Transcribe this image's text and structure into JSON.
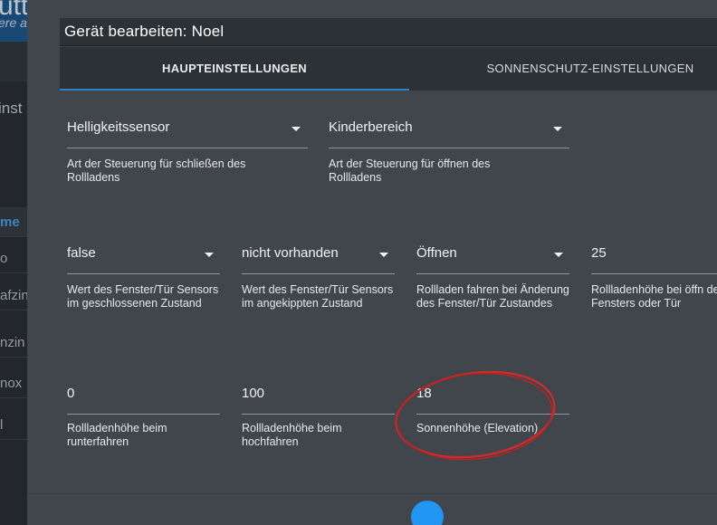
{
  "background": {
    "title_fragment": "utt",
    "subtitle_fragment": "ere a",
    "section_fragment": "inst",
    "list_items": [
      {
        "label": "me",
        "active": true
      },
      {
        "label": "o",
        "active": false
      },
      {
        "label": "afzin",
        "active": false
      },
      {
        "label": "nzin",
        "active": false
      },
      {
        "label": "nox",
        "active": false
      },
      {
        "label": "l",
        "active": false
      }
    ]
  },
  "dialog": {
    "title": "Gerät bearbeiten: Noel",
    "tabs": [
      {
        "label": "HAUPTEINSTELLUNGEN",
        "active": true
      },
      {
        "label": "SONNENSCHUTZ-EINSTELLUNGEN",
        "active": false
      }
    ],
    "fields": {
      "close_control": {
        "value": "Helligkeitssensor",
        "helper": "Art der Steuerung für schließen des Rollladens",
        "type": "select"
      },
      "open_control": {
        "value": "Kinderbereich",
        "helper": "Art der Steuerung für öffnen des Rollladens",
        "type": "select"
      },
      "window_closed": {
        "value": "false",
        "helper": "Wert des Fenster/Tür Sensors im geschlossenen Zustand",
        "type": "select"
      },
      "window_tilted": {
        "value": "nicht vorhanden",
        "helper": "Wert des Fenster/Tür Sensors im angekippten Zustand",
        "type": "select"
      },
      "window_change": {
        "value": "Öffnen",
        "helper": "Rollladen fahren bei Änderung des Fenster/Tür Zustandes",
        "type": "select"
      },
      "open_height": {
        "value": "25",
        "helper": "Rollladenhöhe bei öffn des Fensters oder Tür",
        "type": "text"
      },
      "down_height": {
        "value": "0",
        "helper": "Rollladenhöhe beim runterfahren",
        "type": "text"
      },
      "up_height": {
        "value": "100",
        "helper": "Rollladenhöhe beim hochfahren",
        "type": "text"
      },
      "elevation": {
        "value": "18",
        "helper": "Sonnenhöhe (Elevation)",
        "type": "text"
      }
    }
  },
  "colors": {
    "dialog_bg": "#40464b",
    "header_bg": "#2c3135",
    "accent": "#2f84c8",
    "highlight": "#d22a2a"
  }
}
